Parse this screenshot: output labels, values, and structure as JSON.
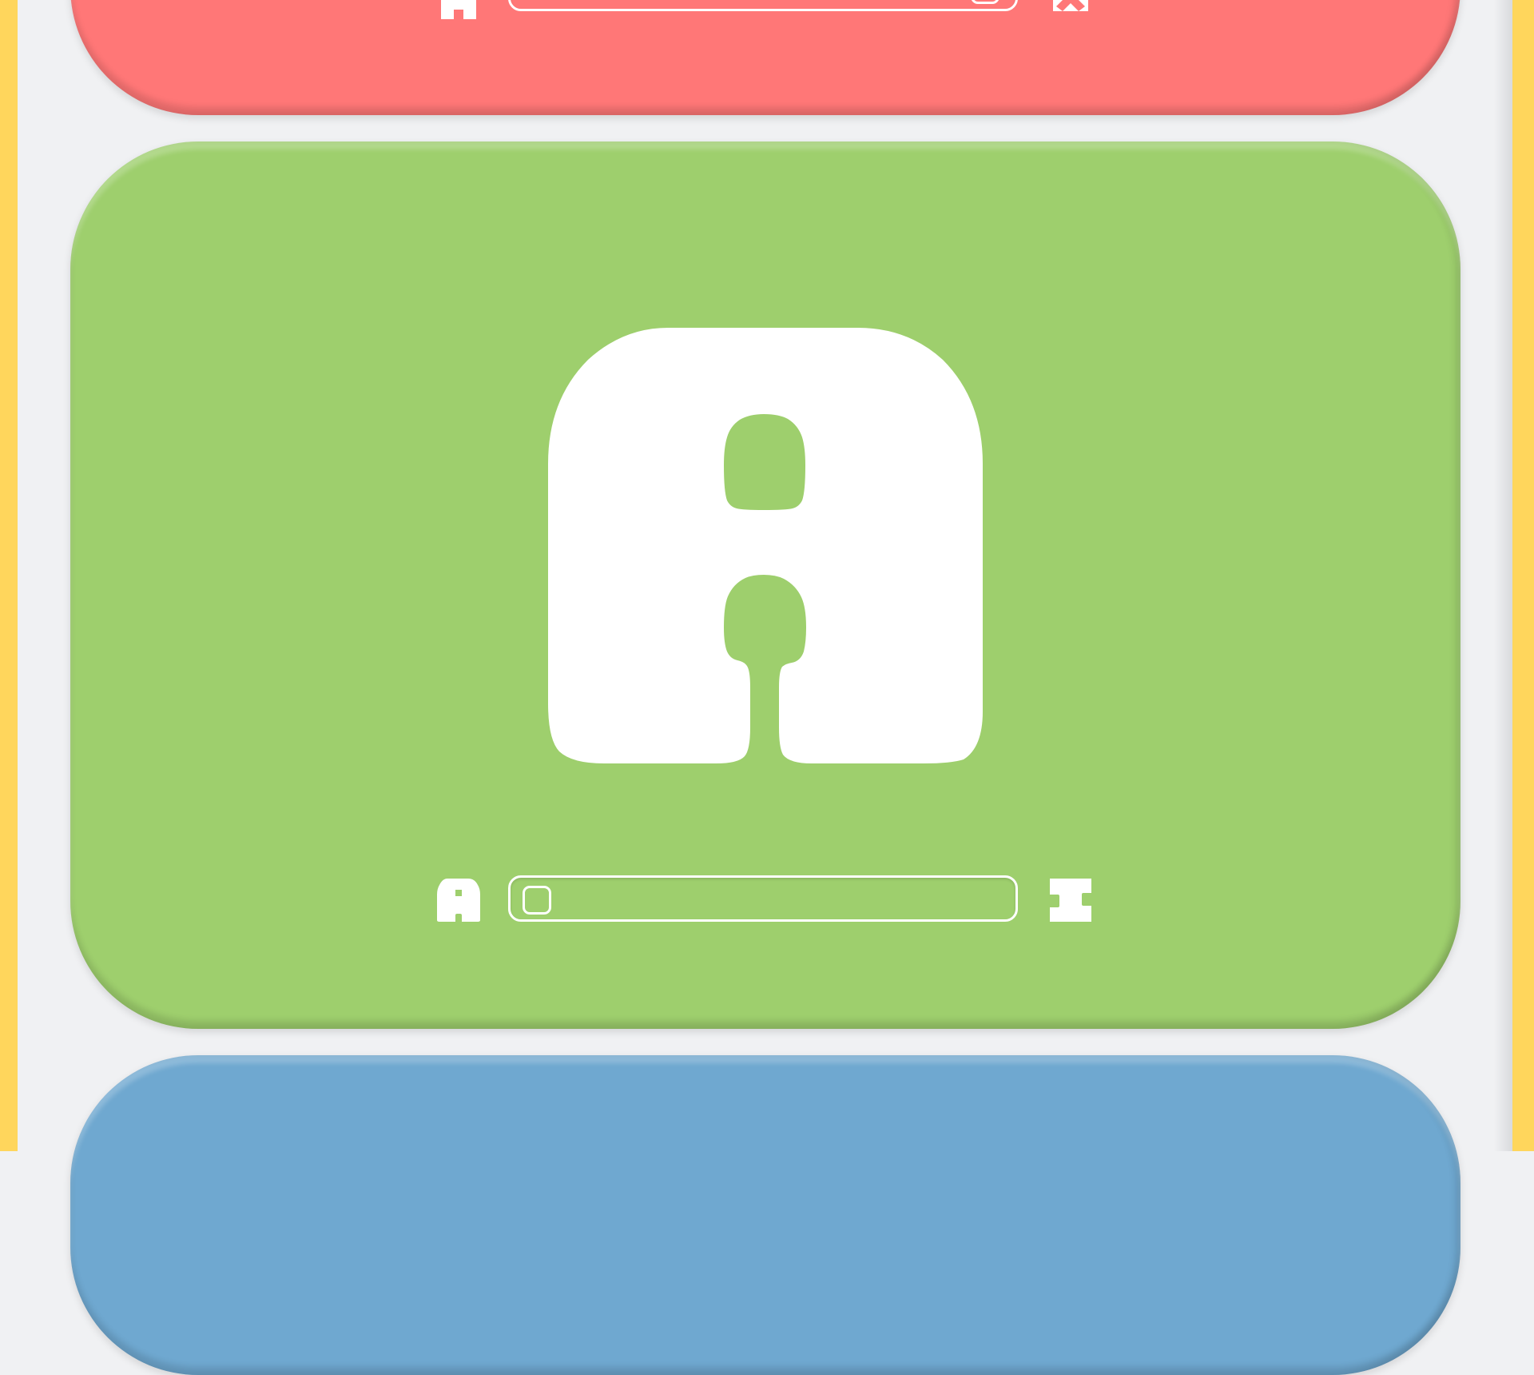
{
  "app": {
    "colors": {
      "background": "#f0f1f3",
      "rail": "#ffd65c",
      "card_red": "#ff7777",
      "card_green": "#9ecf6d",
      "card_blue": "#6fa8d0",
      "foreground": "#ffffff",
      "progress_done": "#3b6d8c"
    }
  },
  "cards": {
    "top": {
      "name": "red-card",
      "slider": {
        "start_label": "A",
        "end_label": "Z",
        "value": 0.97
      }
    },
    "current": {
      "name": "green-card",
      "letter": "A",
      "slider": {
        "start_label": "A",
        "end_label": "Z",
        "value": 0.0
      }
    },
    "bottom": {
      "name": "blue-card"
    }
  }
}
